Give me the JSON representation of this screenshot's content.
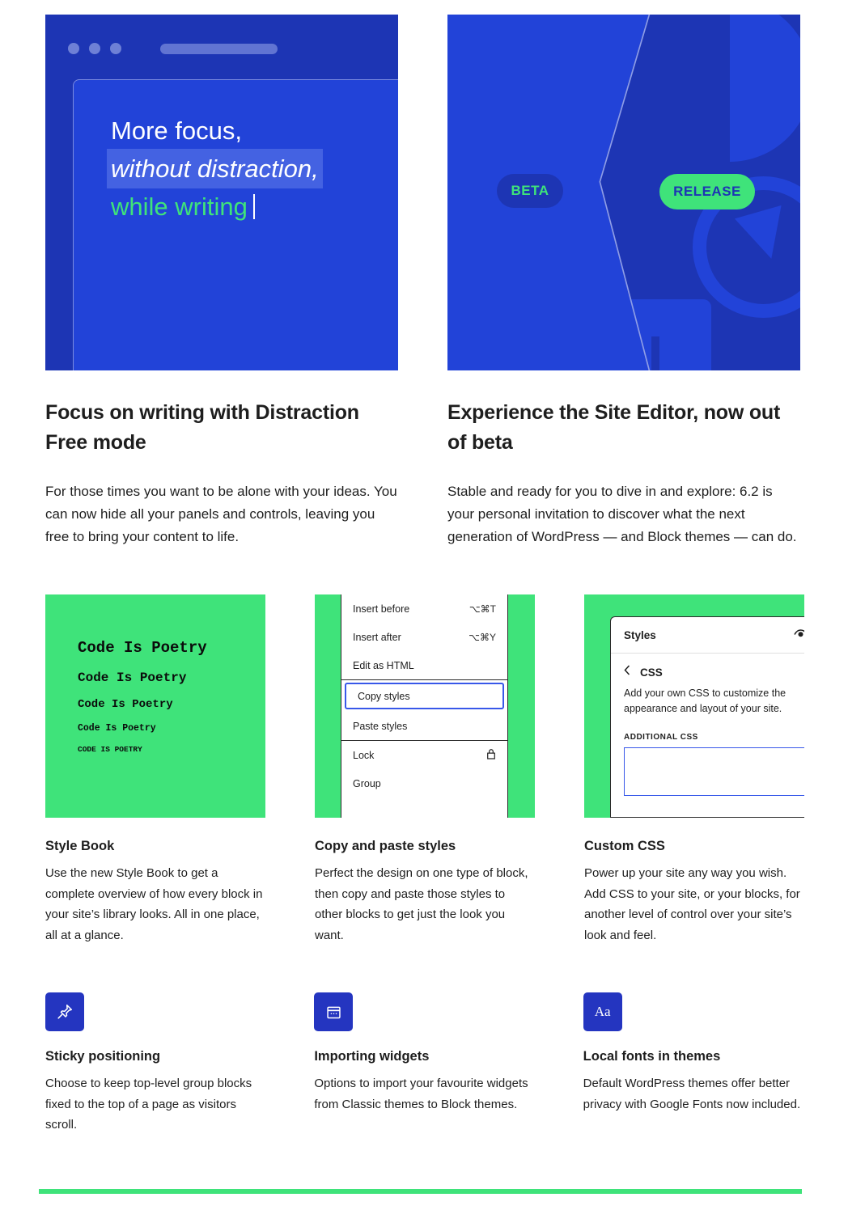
{
  "features": [
    {
      "title": "Focus on writing with Distraction Free mode",
      "body": "For those times you want to be alone with your ideas. You can now hide all your panels and controls, leaving you free to bring your content to life.",
      "mock": {
        "type": "editor-window-mockup",
        "quote_line1": "More focus,",
        "quote_line2": "without distraction,",
        "quote_line3": "while writing"
      }
    },
    {
      "title": "Experience the Site Editor, now out of beta",
      "body": "Stable and ready for you to dive in and explore: 6.2 is your personal invitation to discover what the next generation of WordPress — and Block themes — can do.",
      "mock": {
        "type": "beta-release-mockup",
        "pill_beta": "BETA",
        "pill_release": "RELEASE"
      }
    }
  ],
  "cards": [
    {
      "title": "Style Book",
      "body": "Use the new Style Book to get a complete overview of how every block in your site’s library looks. All in one place, all at a glance.",
      "poetry": [
        "Code Is Poetry",
        "Code Is Poetry",
        "Code Is Poetry",
        "Code Is Poetry",
        "CODE IS POETRY"
      ]
    },
    {
      "title": "Copy and paste styles",
      "body": "Perfect the design on one type of block, then copy and paste those styles to other blocks to get just the look you want.",
      "menu": [
        {
          "label": "Insert before",
          "shortcut": "⌥⌘T"
        },
        {
          "label": "Insert after",
          "shortcut": "⌥⌘Y"
        },
        {
          "label": "Edit as HTML",
          "shortcut": ""
        },
        {
          "label": "Copy styles",
          "shortcut": ""
        },
        {
          "label": "Paste styles",
          "shortcut": ""
        },
        {
          "label": "Lock",
          "shortcut": ""
        },
        {
          "label": "Group",
          "shortcut": ""
        }
      ]
    },
    {
      "title": "Custom CSS",
      "body": "Power up your site any way you wish. Add CSS to your site, or your blocks, for another level of control over your site’s look and feel.",
      "panel": {
        "header": "Styles",
        "breadcrumb": "CSS",
        "description": "Add your own CSS to customize the appearance and layout of your site.",
        "field_label": "ADDITIONAL CSS",
        "field_value": ""
      }
    }
  ],
  "small_items": [
    {
      "icon": "pin-icon",
      "title": "Sticky positioning",
      "body": "Choose to keep top-level group blocks fixed to the top of a page as visitors scroll."
    },
    {
      "icon": "calendar-icon",
      "title": "Importing widgets",
      "body": "Options to import your favourite widgets from Classic themes to Block themes."
    },
    {
      "icon": "typography-icon",
      "title": "Local fonts in themes",
      "body": "Default WordPress themes offer better privacy with Google Fonts now included.",
      "icon_text": "Aa"
    }
  ],
  "colors": {
    "blue_dark": "#1d35b4",
    "blue": "#2243d8",
    "green": "#3fe37a",
    "accent_blue": "#3858e9",
    "icon_blue": "#2435c0"
  }
}
